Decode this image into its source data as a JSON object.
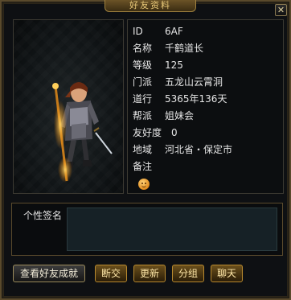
{
  "window": {
    "title": "好友资料",
    "close_label": "✕"
  },
  "info": {
    "rows": [
      {
        "label": "ID",
        "value": "6AF"
      },
      {
        "label": "名称",
        "value": "千鹤道长"
      },
      {
        "label": "等级",
        "value": "125"
      },
      {
        "label": "门派",
        "value": "五龙山云霄洞"
      },
      {
        "label": "道行",
        "value": "5365年136天"
      },
      {
        "label": "帮派",
        "value": "姐妹会"
      },
      {
        "label": "友好度",
        "value": "0"
      },
      {
        "label": "地域",
        "value": "河北省・保定市"
      },
      {
        "label": "备注",
        "value": ""
      }
    ]
  },
  "signature": {
    "label": "个性签名",
    "value": ""
  },
  "buttons": {
    "achievements": "查看好友成就",
    "break": "断交",
    "refresh": "更新",
    "group": "分组",
    "chat": "聊天"
  }
}
